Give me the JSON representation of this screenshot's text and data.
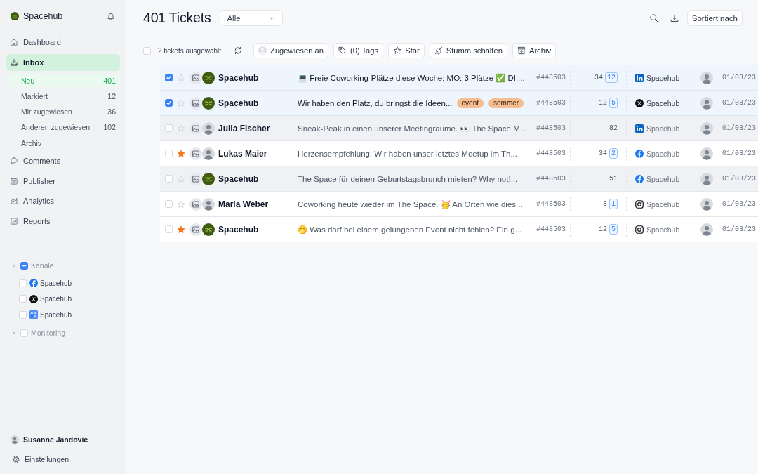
{
  "sidebar": {
    "brand": "Spacehub",
    "nav": [
      {
        "label": "Dashboard",
        "selected": false
      },
      {
        "label": "Inbox",
        "selected": true,
        "children": [
          {
            "label": "Neu",
            "count": "401",
            "selected": true
          },
          {
            "label": "Markiert",
            "count": "12",
            "selected": false
          },
          {
            "label": "Mir zugewiesen",
            "count": "36",
            "selected": false
          },
          {
            "label": "Anderen zugewiesen",
            "count": "102",
            "selected": false
          },
          {
            "label": "Archiv",
            "selected": false
          }
        ]
      },
      {
        "label": "Comments",
        "selected": false
      },
      {
        "label": "Publisher",
        "selected": false
      },
      {
        "label": "Analytics",
        "selected": false
      },
      {
        "label": "Reports",
        "selected": false
      }
    ],
    "tree": [
      {
        "label": "Kanäle",
        "checked": false,
        "indeterminate": true,
        "children": [
          {
            "label": "Spacehub",
            "kind": "facebook",
            "checked": false
          },
          {
            "label": "Spacehub",
            "kind": "x",
            "checked": false
          },
          {
            "label": "Spacehub",
            "kind": "grid",
            "checked": false
          }
        ]
      },
      {
        "label": "Monitoring",
        "checked": false,
        "indeterminate": false
      }
    ],
    "user": "Susanne Jandovic",
    "settings": "Einstellungen"
  },
  "header": {
    "title": "401 Tickets",
    "filter": "Alle",
    "sort_button": "Sortiert nach"
  },
  "toolbar": {
    "select_all_checked": false,
    "selection_label": "2 tickets ausgewählt",
    "actions": [
      "Zugewiesen an",
      "(0) Tags",
      "Star",
      "Stumm schalten",
      "Archiv"
    ]
  },
  "rows": [
    {
      "selected": true,
      "starred": false,
      "shaded": false,
      "unread": true,
      "author": {
        "name": "Spacehub",
        "kind": "logo"
      },
      "message": "💻 Freie Coworking-Plätze diese Woche: MO: 3 Plätze ✅ DI:...",
      "tags": [],
      "ticket": "#448503",
      "count": "34",
      "badge": "12",
      "channel": {
        "kind": "linkedin",
        "name": "Spacehub"
      },
      "date": "01/03/23"
    },
    {
      "selected": true,
      "starred": false,
      "shaded": false,
      "unread": true,
      "author": {
        "name": "Spacehub",
        "kind": "logo"
      },
      "message": "Wir haben den Platz, du bringst die Ideen...",
      "tags": [
        "event",
        "sommer"
      ],
      "ticket": "#448503",
      "count": "12",
      "badge": "5",
      "channel": {
        "kind": "x",
        "name": "Spacehub"
      },
      "date": "01/03/23"
    },
    {
      "selected": false,
      "starred": false,
      "shaded": true,
      "unread": false,
      "author": {
        "name": "Julia Fischer",
        "kind": "person"
      },
      "message": "Sneak-Peak in einen unserer Meetingräume. 👀 The Space M...",
      "tags": [],
      "ticket": "#448503",
      "count": "82",
      "channel": {
        "kind": "linkedin",
        "name": "Spacehub"
      },
      "date": "01/03/23"
    },
    {
      "selected": false,
      "starred": true,
      "shaded": false,
      "unread": false,
      "author": {
        "name": "Lukas Maier",
        "kind": "person"
      },
      "message": "Herzensempfehlung: Wir haben unser letztes Meetup im Th...",
      "tags": [],
      "ticket": "#448503",
      "count": "34",
      "badge": "2",
      "channel": {
        "kind": "facebook",
        "name": "Spacehub"
      },
      "date": "01/03/23"
    },
    {
      "selected": false,
      "starred": false,
      "shaded": true,
      "unread": false,
      "author": {
        "name": "Spacehub",
        "kind": "logo"
      },
      "message": "The Space für deinen Geburtstagsbrunch mieten? Why not!...",
      "tags": [],
      "ticket": "#448503",
      "count": "51",
      "channel": {
        "kind": "facebook",
        "name": "Spacehub"
      },
      "date": "01/03/23"
    },
    {
      "selected": false,
      "starred": false,
      "shaded": false,
      "unread": false,
      "author": {
        "name": "Maria Weber",
        "kind": "person"
      },
      "message": "Coworking heute wieder im The Space. 🥳 An Orten wie dies...",
      "tags": [],
      "ticket": "#448503",
      "count": "8",
      "badge": "1",
      "channel": {
        "kind": "instagram",
        "name": "Spacehub"
      },
      "date": "01/03/23"
    },
    {
      "selected": false,
      "starred": true,
      "shaded": false,
      "unread": false,
      "author": {
        "name": "Spacehub",
        "kind": "logo"
      },
      "message": "🤭 Was darf bei einem gelungenen Event nicht fehlen? Ein g...",
      "tags": [],
      "ticket": "#448503",
      "count": "12",
      "badge": "5",
      "channel": {
        "kind": "instagram",
        "name": "Spacehub"
      },
      "date": "01/03/23"
    }
  ]
}
